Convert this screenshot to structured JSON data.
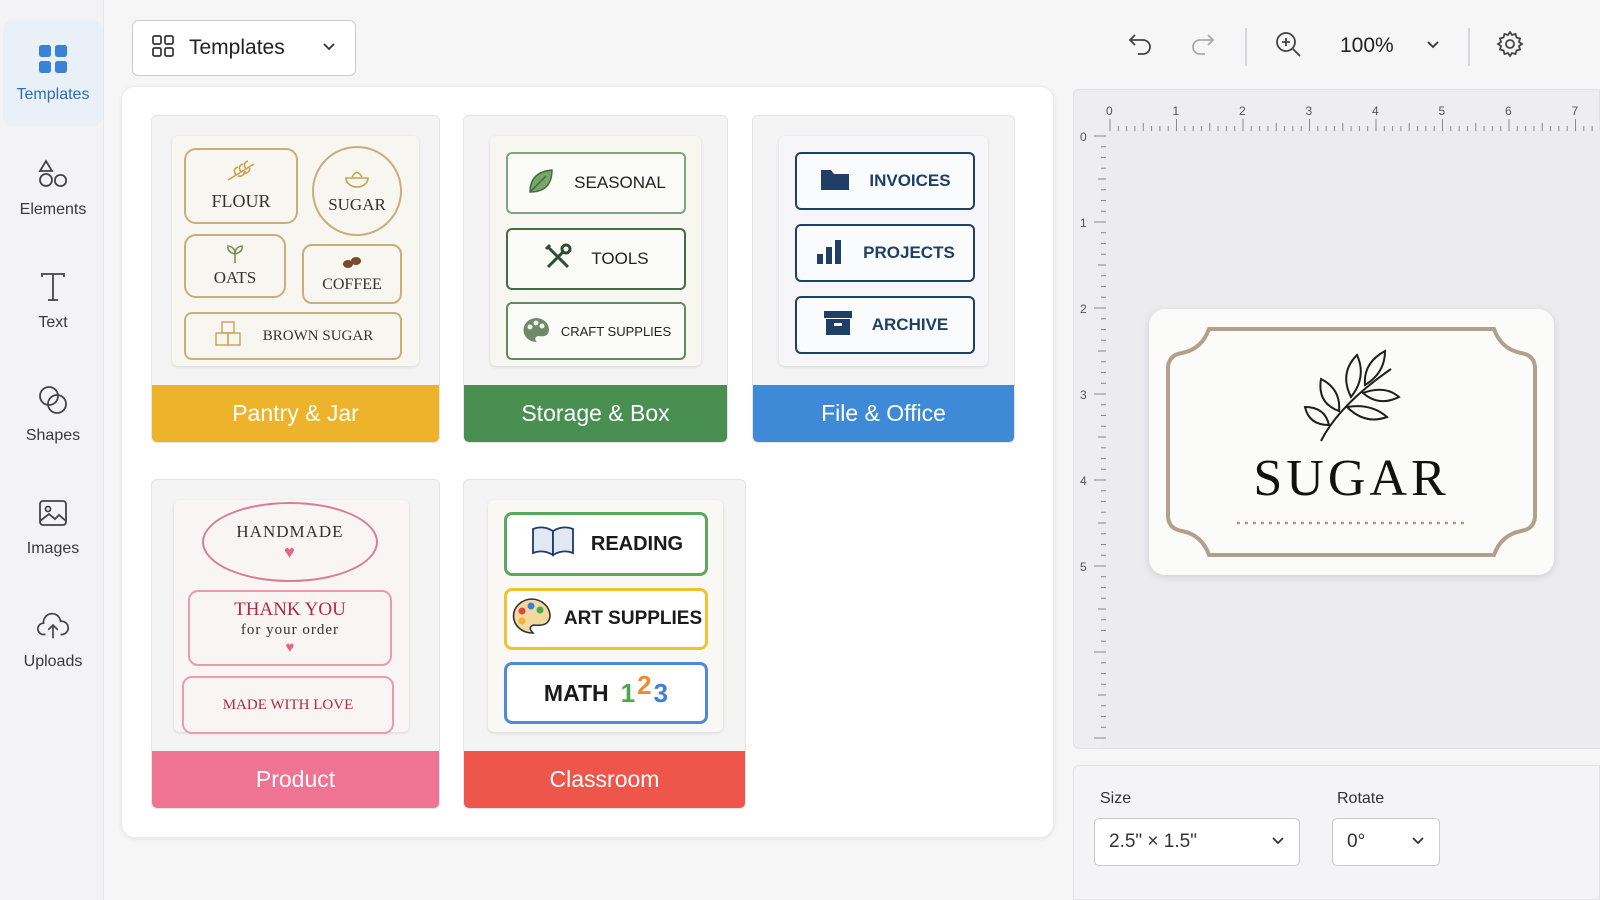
{
  "sidebar": {
    "items": [
      {
        "label": "Templates",
        "icon": "grid-icon",
        "active": true
      },
      {
        "label": "Elements",
        "icon": "elements-icon"
      },
      {
        "label": "Text",
        "icon": "text-icon"
      },
      {
        "label": "Shapes",
        "icon": "shapes-icon"
      },
      {
        "label": "Images",
        "icon": "image-icon"
      },
      {
        "label": "Uploads",
        "icon": "upload-cloud-icon"
      }
    ]
  },
  "toolbar": {
    "templates_dropdown": "Templates",
    "zoom": "100%"
  },
  "templates": {
    "pantry": {
      "banner": "Pantry & Jar",
      "color": "#edb32a",
      "labels": {
        "flour": "FLOUR",
        "sugar": "SUGAR",
        "oats": "OATS",
        "coffee": "COFFEE",
        "brown_sugar": "BROWN SUGAR"
      }
    },
    "storage": {
      "banner": "Storage & Box",
      "color": "#4a8f52",
      "labels": {
        "seasonal": "SEASONAL",
        "tools": "TOOLS",
        "craft": "CRAFT SUPPLIES"
      }
    },
    "office": {
      "banner": "File & Office",
      "color": "#3f8ad6",
      "labels": {
        "invoices": "INVOICES",
        "projects": "PROJECTS",
        "archive": "ARCHIVE"
      }
    },
    "product": {
      "banner": "Product",
      "color": "#ef7392",
      "labels": {
        "handmade": "HANDMADE",
        "thank_you": "THANK YOU",
        "for_order": "for your order",
        "made_love": "MADE WITH LOVE"
      }
    },
    "classroom": {
      "banner": "Classroom",
      "color": "#ee564b",
      "labels": {
        "reading": "READING",
        "art": "ART SUPPLIES",
        "math": "MATH",
        "d1": "1",
        "d2": "2",
        "d3": "3"
      }
    }
  },
  "canvas": {
    "ruler_top": [
      "0",
      "1",
      "2",
      "3",
      "4",
      "5",
      "6",
      "7"
    ],
    "ruler_left": [
      "0",
      "1",
      "2",
      "3",
      "4",
      "5"
    ],
    "label_text": "SUGAR"
  },
  "properties": {
    "size_label": "Size",
    "size_value": "2.5\" × 1.5\"",
    "rotate_label": "Rotate",
    "rotate_value": "0°"
  }
}
